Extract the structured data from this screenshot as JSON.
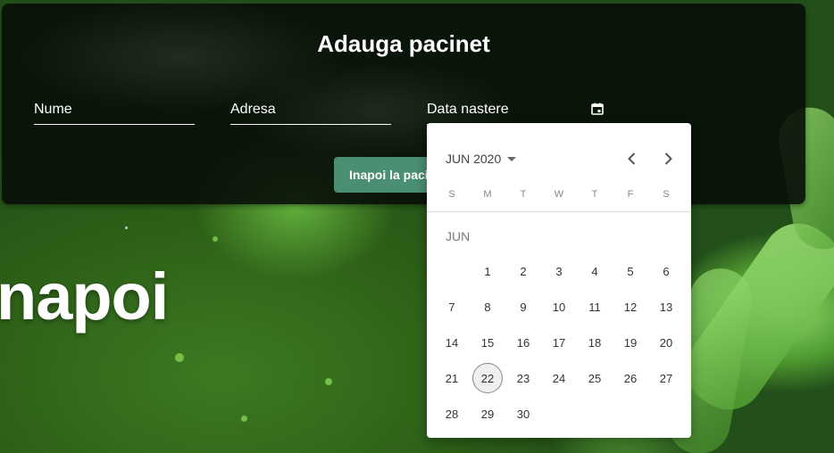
{
  "background": {
    "big_text": "napoi"
  },
  "card": {
    "title": "Adauga pacinet",
    "fields": {
      "nume_label": "Nume",
      "adresa_label": "Adresa",
      "data_nastere_label": "Data nastere"
    },
    "back_button_label": "Inapoi la pacienti"
  },
  "datepicker": {
    "period_label": "JUN 2020",
    "weekdays": [
      "S",
      "M",
      "T",
      "W",
      "T",
      "F",
      "S"
    ],
    "month_label": "JUN",
    "leading_blanks": 1,
    "days": [
      "1",
      "2",
      "3",
      "4",
      "5",
      "6",
      "7",
      "8",
      "9",
      "10",
      "11",
      "12",
      "13",
      "14",
      "15",
      "16",
      "17",
      "18",
      "19",
      "20",
      "21",
      "22",
      "23",
      "24",
      "25",
      "26",
      "27",
      "28",
      "29",
      "30"
    ],
    "today": "22"
  },
  "colors": {
    "button": "#4b8f72",
    "card": "#080e08"
  },
  "icons": {
    "calendar": "calendar-icon",
    "prev": "chevron-left-icon",
    "next": "chevron-right-icon",
    "dropdown": "caret-down-icon"
  }
}
